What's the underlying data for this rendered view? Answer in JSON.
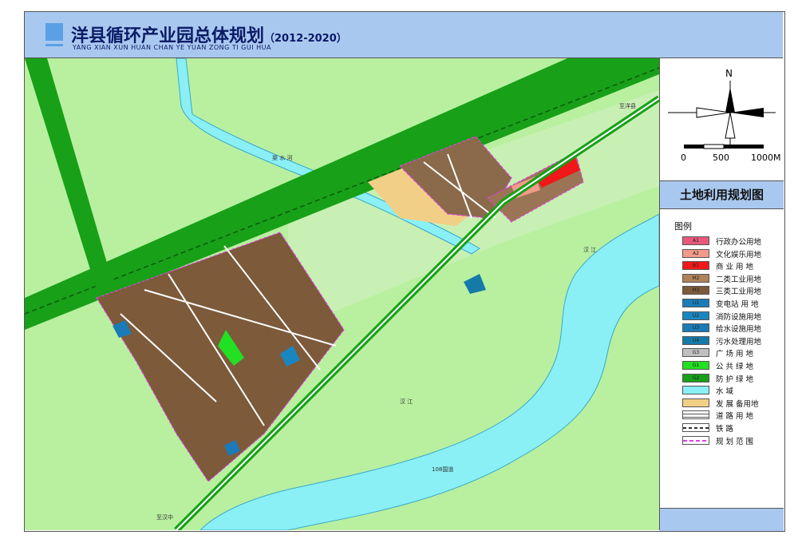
{
  "header": {
    "title": "洋县循环产业园总体规划",
    "years": "（2012-2020）",
    "subtitle": "YANG XIAN XUN HUAN CHAN YE YUAN ZONG TI GUI HUA"
  },
  "panel": {
    "north": "N",
    "scale": {
      "s0": "0",
      "s500": "500",
      "s1000": "1000M"
    },
    "title": "土地利用规划图",
    "legend_heading": "图例",
    "legend": [
      {
        "code": "A1",
        "label": "行政办公用地",
        "color": "#e8587a"
      },
      {
        "code": "A2",
        "label": "文化娱乐用地",
        "color": "#f29a8a"
      },
      {
        "code": "B1",
        "label": "商 业 用 地",
        "color": "#f01818"
      },
      {
        "code": "M2",
        "label": "二类工业用地",
        "color": "#b0825a"
      },
      {
        "code": "M3",
        "label": "三类工业用地",
        "color": "#7c5a3a"
      },
      {
        "code": "U1",
        "label": "变电站 用 地",
        "color": "#1a7bb8"
      },
      {
        "code": "U2",
        "label": "消防设施用地",
        "color": "#1a86c0"
      },
      {
        "code": "U3",
        "label": "给水设施用地",
        "color": "#1a7bb8"
      },
      {
        "code": "U4",
        "label": "污水处理用地",
        "color": "#167aa8"
      },
      {
        "code": "G3",
        "label": "广 场 用 地",
        "color": "#c0c0c0"
      },
      {
        "code": "G1",
        "label": "公 共 绿 地",
        "color": "#22e022"
      },
      {
        "code": "G2",
        "label": "防 护 绿 地",
        "color": "#18a018"
      },
      {
        "code": "",
        "label": "水        域",
        "color": "#8af0f5"
      },
      {
        "code": "",
        "label": "发 展 备用地",
        "color": "#f2cf86"
      },
      {
        "code": "",
        "label": "道 路 用 地",
        "color": "#ffffff"
      },
      {
        "code": "",
        "label": "铁        路",
        "color": "#ffffff"
      },
      {
        "code": "",
        "label": "规 划 范 围",
        "color": "#ffffff"
      }
    ]
  },
  "map_labels": {
    "river1": "汉 江",
    "river2": "汉 江",
    "road_east": "至洋县",
    "road_sw": "至汉中",
    "canal": "渠 水 河",
    "highway": "108国道"
  }
}
